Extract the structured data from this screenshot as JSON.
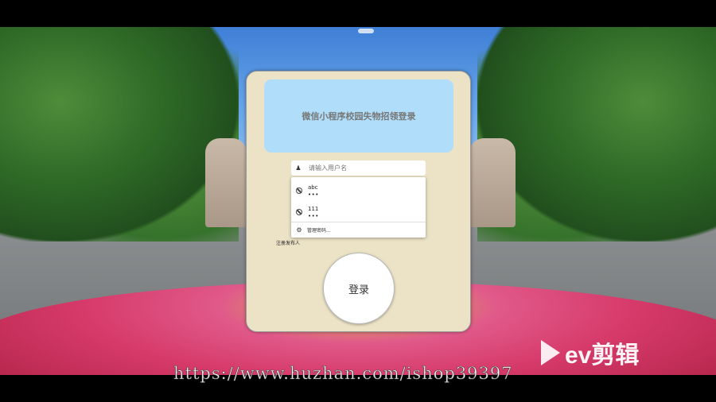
{
  "page": {
    "title": "微信小程序校园失物招领登录"
  },
  "login": {
    "username_placeholder": "请输入用户名",
    "autocomplete": [
      {
        "username": "abc",
        "password_mask": "•••"
      },
      {
        "username": "111",
        "password_mask": "•••"
      }
    ],
    "manage_passwords_label": "管理密码...",
    "register_link": "注册发布人",
    "login_button": "登录"
  },
  "overlay": {
    "watermark_url": "https://www.huzhan.com/ishop39397",
    "brand": "ev剪辑"
  },
  "icons": {
    "username_field": "user-icon",
    "autocomplete_item": "key-icon",
    "manage_passwords": "gear-icon",
    "brand": "play-icon"
  },
  "colors": {
    "card_background": "#ece3c6",
    "banner_background": "#b0defa"
  }
}
